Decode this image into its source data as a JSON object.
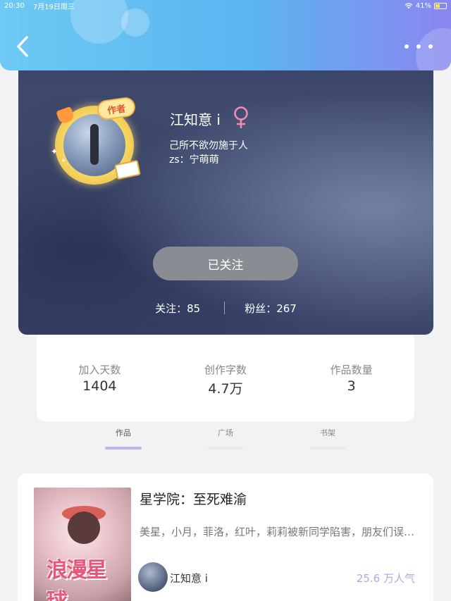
{
  "status_bar": {
    "time": "20:30",
    "date": "7月19日周三",
    "battery": "41%"
  },
  "profile": {
    "name": "江知意 i",
    "gender_symbol": "♀",
    "badge": "作者",
    "bio": "己所不欲勿施于人",
    "zs": "zs：宁萌萌",
    "follow_button": "已关注",
    "following_label": "关注：85",
    "followers_label": "粉丝：267"
  },
  "stats": [
    {
      "label": "加入天数",
      "value": "1404"
    },
    {
      "label": "创作字数",
      "value": "4.7万"
    },
    {
      "label": "作品数量",
      "value": "3"
    }
  ],
  "tabs": [
    {
      "label": "作品",
      "active": true
    },
    {
      "label": "广场",
      "active": false
    },
    {
      "label": "书架",
      "active": false
    }
  ],
  "book": {
    "title": "星学院：至死难渝",
    "description": "美星，小月，菲洛，红叶，莉莉被新同学陷害，朋友们误会…",
    "author": "江知意 i",
    "popularity": "25.6 万人气",
    "cover_text": "浪漫星球"
  },
  "colors": {
    "header_gradient_start": "#6ec9f5",
    "header_gradient_end": "#8a86f0",
    "profile_bg": "#3a4468",
    "follow_button_bg": "#8a8c94",
    "active_tab_underline": "#c5b3ec",
    "popularity_text": "#b9a2e6"
  }
}
